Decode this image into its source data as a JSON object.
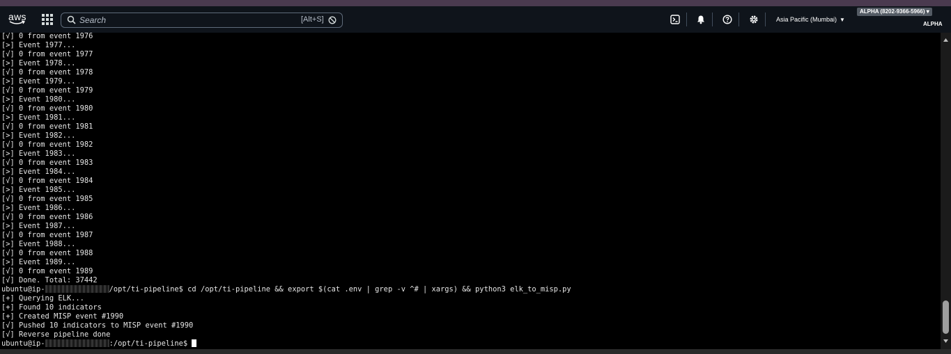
{
  "nav": {
    "logo_text": "aws",
    "search_placeholder": "Search",
    "search_shortcut": "[Alt+S]",
    "region_label": "Asia Pacific (Mumbai)",
    "account_badge": "ALPHA (8202-9366-5966) ▾",
    "account_name": "ALPHA",
    "icons": [
      "cloudshell-icon",
      "bell-icon",
      "help-icon",
      "gear-icon"
    ]
  },
  "terminal": {
    "lines": [
      "[√] 0 from event 1976",
      "[>] Event 1977...",
      "[√] 0 from event 1977",
      "[>] Event 1978...",
      "[√] 0 from event 1978",
      "[>] Event 1979...",
      "[√] 0 from event 1979",
      "[>] Event 1980...",
      "[√] 0 from event 1980",
      "[>] Event 1981...",
      "[√] 0 from event 1981",
      "[>] Event 1982...",
      "[√] 0 from event 1982",
      "[>] Event 1983...",
      "[√] 0 from event 1983",
      "[>] Event 1984...",
      "[√] 0 from event 1984",
      "[>] Event 1985...",
      "[√] 0 from event 1985",
      "[>] Event 1986...",
      "[√] 0 from event 1986",
      "[>] Event 1987...",
      "[√] 0 from event 1987",
      "[>] Event 1988...",
      "[√] 0 from event 1988",
      "[>] Event 1989...",
      "[√] 0 from event 1989",
      "[√] Done. Total: 37442"
    ],
    "prompt1_user": "ubuntu@ip-",
    "prompt1_path": "/opt/ti-pipeline$",
    "prompt1_command": " cd /opt/ti-pipeline && export $(cat .env | grep -v ^# | xargs) && python3 elk_to_misp.py",
    "output": [
      "[+] Querying ELK...",
      "[+] Found 10 indicators",
      "[+] Created MISP event #1990",
      "[√] Pushed 10 indicators to MISP event #1990",
      "[√] Reverse pipeline done"
    ],
    "prompt2_user": "ubuntu@ip-",
    "prompt2_path": ":/opt/ti-pipeline$"
  }
}
